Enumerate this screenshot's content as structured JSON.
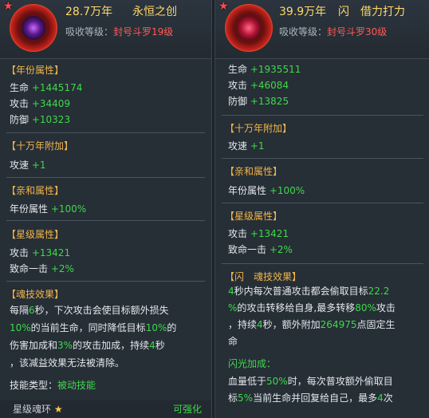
{
  "left": {
    "power": "28.7万年",
    "name": "永恒之创",
    "absorb_label": "吸收等级：",
    "absorb_value": "封号斗罗19级",
    "sec1_title": "【年份属性】",
    "s1": [
      {
        "label": "生命",
        "value": "+1445174"
      },
      {
        "label": "攻击",
        "value": "+34409"
      },
      {
        "label": "防御",
        "value": "+10323"
      }
    ],
    "sec2_title": "【十万年附加】",
    "s2": [
      {
        "label": "攻速",
        "value": "+1"
      }
    ],
    "sec3_title": "【亲和属性】",
    "s3": [
      {
        "label": "年份属性",
        "value": "+100%"
      }
    ],
    "sec4_title": "【星级属性】",
    "s4": [
      {
        "label": "攻击",
        "value": "+13421"
      },
      {
        "label": "致命一击",
        "value": "+2%"
      }
    ],
    "sec5_title": "【魂技效果】",
    "effect": {
      "a1": "每隔",
      "n1": "6",
      "a2": "秒，下次攻击会使目标额外损失",
      "n2": "10%",
      "a3": "的当前生命，同时降低目标",
      "n3": "10%",
      "a4": "的",
      "a5": "伤害加成和",
      "n4": "3%",
      "a6": "的攻击加成，持续",
      "n5": "4",
      "a7": "秒",
      "a8": "，该减益效果无法被清除。"
    },
    "skill_type_label": "技能类型：",
    "skill_type_value": "被动技能",
    "star_ring": "星级魂环",
    "enhance": "可强化"
  },
  "right": {
    "power": "39.9万年",
    "name": "闪　借力打力",
    "absorb_label": "吸收等级：",
    "absorb_value": "封号斗罗30级",
    "s0": [
      {
        "label": "生命",
        "value": "+1935511"
      },
      {
        "label": "攻击",
        "value": "+46084"
      },
      {
        "label": "防御",
        "value": "+13825"
      }
    ],
    "sec2_title": "【十万年附加】",
    "s2": [
      {
        "label": "攻速",
        "value": "+1"
      }
    ],
    "sec3_title": "【亲和属性】",
    "s3": [
      {
        "label": "年份属性",
        "value": "+100%"
      }
    ],
    "sec4_title": "【星级属性】",
    "s4": [
      {
        "label": "攻击",
        "value": "+13421"
      },
      {
        "label": "致命一击",
        "value": "+2%"
      }
    ],
    "sec5_title": "【闪　魂技效果】",
    "effect": {
      "n1": "4",
      "a1": "秒内每次普通攻击都会偷取目标",
      "n2": "22.2",
      "n2b": "%",
      "a2": "的攻击转移给自身,最多转移",
      "n3": "80%",
      "a3": "攻击",
      "a4": "，持续",
      "n4": "4",
      "a5": "秒，额外附加",
      "n5": "264975",
      "a6": "点固定生",
      "a7": "命"
    },
    "flash_title": "闪光加成：",
    "flash": {
      "b1": "血量低于",
      "m1": "50%",
      "b2": "时，每次普攻额外偷取目",
      "b3": "标",
      "m2": "5%",
      "b4": "当前生命并回复给自己，最多",
      "m3": "4",
      "b5": "次"
    }
  }
}
